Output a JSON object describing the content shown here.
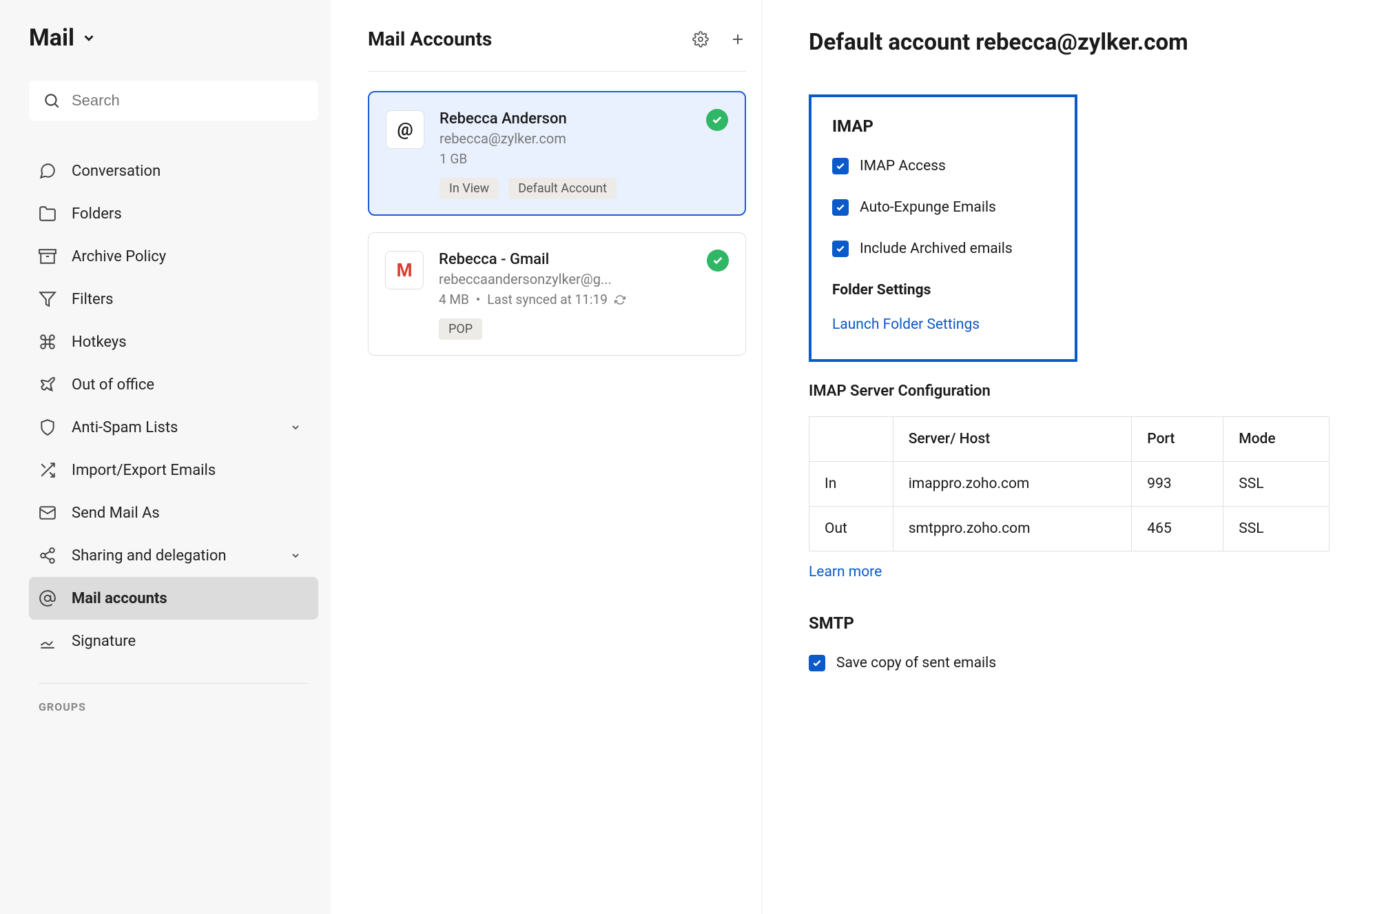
{
  "sidebar": {
    "title": "Mail",
    "search_placeholder": "Search",
    "items": [
      {
        "label": "Conversation"
      },
      {
        "label": "Folders"
      },
      {
        "label": "Archive Policy"
      },
      {
        "label": "Filters"
      },
      {
        "label": "Hotkeys"
      },
      {
        "label": "Out of office"
      },
      {
        "label": "Anti-Spam Lists",
        "expandable": true
      },
      {
        "label": "Import/Export Emails"
      },
      {
        "label": "Send Mail As"
      },
      {
        "label": "Sharing and delegation",
        "expandable": true
      },
      {
        "label": "Mail accounts",
        "active": true
      },
      {
        "label": "Signature"
      }
    ],
    "groups_label": "GROUPS"
  },
  "accounts": {
    "title": "Mail Accounts",
    "list": [
      {
        "name": "Rebecca Anderson",
        "email": "rebecca@zylker.com",
        "size": "1 GB",
        "badges": [
          "In View",
          "Default Account"
        ],
        "verified": true,
        "selected": true,
        "avatar": "@"
      },
      {
        "name": "Rebecca - Gmail",
        "email": "rebeccaandersonzylker@g...",
        "size": "4 MB",
        "sync": "Last synced at 11:19",
        "badges": [
          "POP"
        ],
        "verified": true,
        "gmail": true
      }
    ]
  },
  "main": {
    "title": "Default account rebecca@zylker.com",
    "imap": {
      "heading": "IMAP",
      "options": [
        "IMAP Access",
        "Auto-Expunge Emails",
        "Include Archived emails"
      ],
      "folder_heading": "Folder Settings",
      "folder_link": "Launch Folder Settings"
    },
    "server": {
      "heading": "IMAP Server Configuration",
      "headers": [
        "",
        "Server/ Host",
        "Port",
        "Mode"
      ],
      "rows": [
        {
          "dir": "In",
          "host": "imappro.zoho.com",
          "port": "993",
          "mode": "SSL"
        },
        {
          "dir": "Out",
          "host": "smtppro.zoho.com",
          "port": "465",
          "mode": "SSL"
        }
      ],
      "learn_more": "Learn more"
    },
    "smtp": {
      "heading": "SMTP",
      "option": "Save copy of sent emails"
    }
  }
}
